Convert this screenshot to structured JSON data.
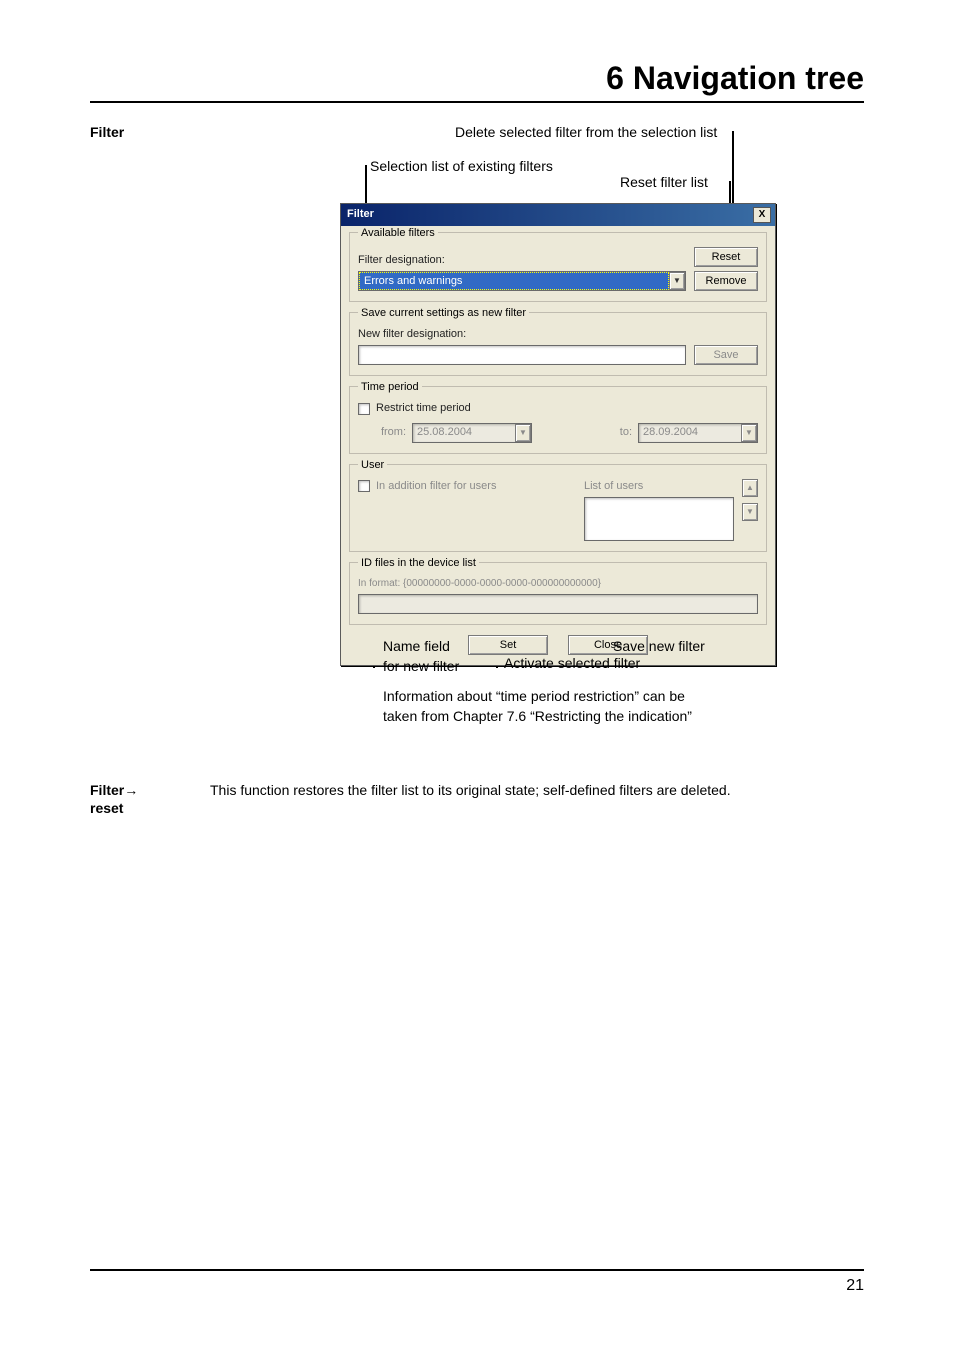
{
  "page": {
    "chapter_title": "6 Navigation tree",
    "page_number": "21"
  },
  "margin": {
    "filter": "Filter",
    "filter_reset_line1": "Filter",
    "filter_reset_arrow": "→",
    "filter_reset_line2": "reset"
  },
  "body": {
    "filter_reset_text": "This function restores the filter list to its original state; self-defined filters are deleted."
  },
  "annotations": {
    "delete_selected": "Delete selected filter from the selection list",
    "selection_list": "Selection list of existing filters",
    "reset_list": "Reset filter list",
    "save_new": "Save new filter",
    "name_field_l1": "Name field",
    "name_field_l2": "for new filter",
    "activate": "Activate selected filter",
    "info_l1": "Information about “time period restriction” can be",
    "info_l2": "taken from Chapter 7.6 “Restricting the indication”"
  },
  "dialog": {
    "title": "Filter",
    "close_x": "X",
    "groups": {
      "available": {
        "title": "Available filters",
        "filter_designation_label": "Filter designation:",
        "filter_designation_value": "Errors and warnings",
        "reset_btn": "Reset",
        "remove_btn": "Remove"
      },
      "save": {
        "title": "Save current settings as new filter",
        "label": "New filter designation:",
        "value": "",
        "save_btn": "Save"
      },
      "time": {
        "title": "Time period",
        "restrict_label": "Restrict time period",
        "from_label": "from:",
        "from_value": "25.08.2004",
        "to_label": "to:",
        "to_value": "28.09.2004"
      },
      "user": {
        "title": "User",
        "addition_label": "In addition filter for users",
        "list_label": "List of users"
      },
      "iddevice": {
        "title": "ID files in the device list",
        "format": "In format: {00000000-0000-0000-0000-000000000000}",
        "value": ""
      }
    },
    "buttons": {
      "set": "Set",
      "close": "Close"
    }
  }
}
